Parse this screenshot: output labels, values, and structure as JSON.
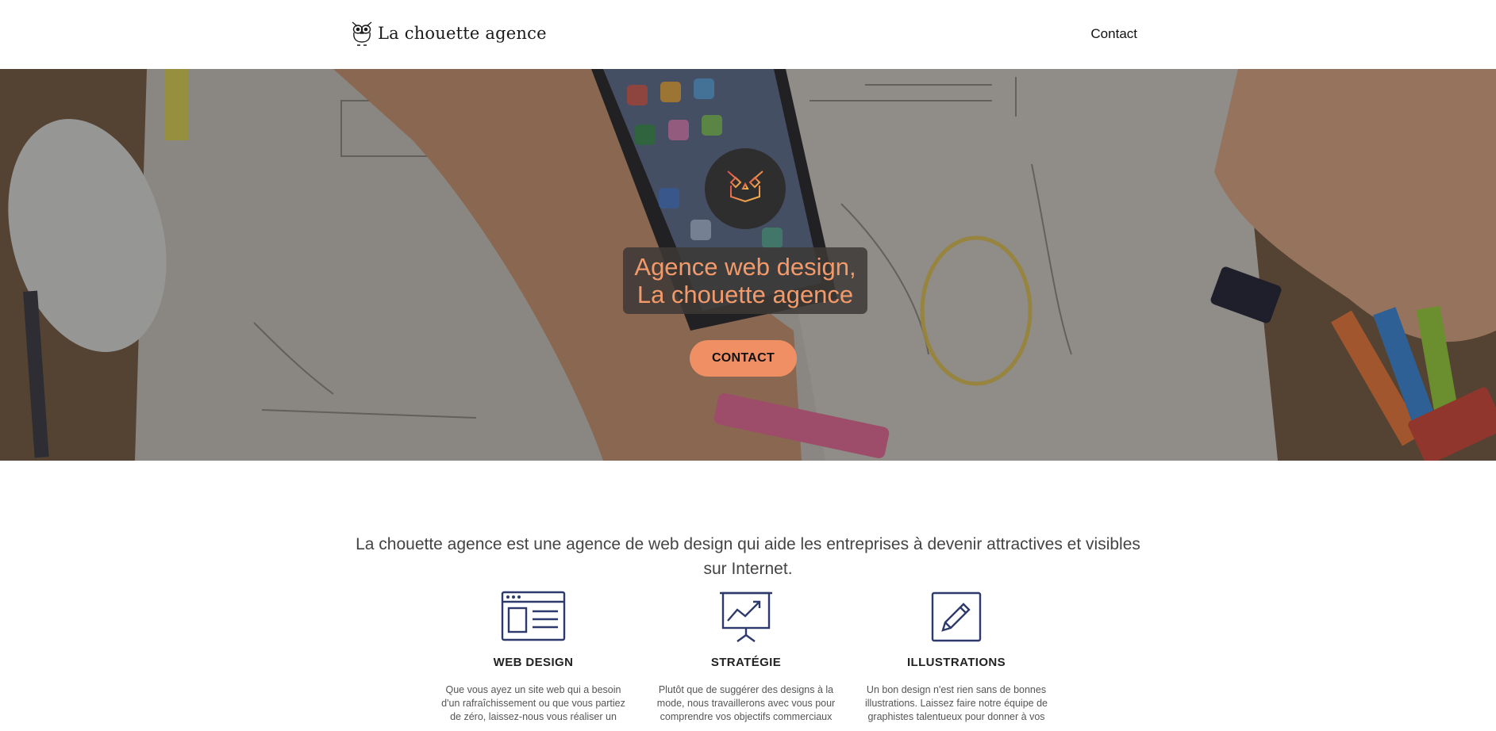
{
  "header": {
    "logo_text": "La chouette agence",
    "nav": {
      "contact_label": "Contact"
    }
  },
  "hero": {
    "title_line1": "Agence web design,",
    "title_line2": "La chouette agence",
    "cta_label": "CONTACT",
    "colors": {
      "accent": "#f08f64",
      "title": "#f39a6a",
      "emblem_bg": "#2f2e2e"
    }
  },
  "intro": {
    "text": "La chouette agence est une agence de web design qui aide les entreprises à devenir attractives et visibles sur Internet."
  },
  "services": [
    {
      "icon": "browser-window-icon",
      "title": "WEB DESIGN",
      "text": "Que vous ayez un site web qui a besoin d'un rafraîchissement ou que vous partiez de zéro, laissez-nous vous réaliser un"
    },
    {
      "icon": "presentation-chart-icon",
      "title": "STRATÉGIE",
      "text": "Plutôt que de suggérer des designs à la mode, nous travaillerons avec vous pour comprendre vos objectifs commerciaux"
    },
    {
      "icon": "pencil-edit-icon",
      "title": "ILLUSTRATIONS",
      "text": "Un bon design n'est rien sans de bonnes illustrations. Laissez faire notre équipe de graphistes talentueux pour donner à vos"
    }
  ]
}
